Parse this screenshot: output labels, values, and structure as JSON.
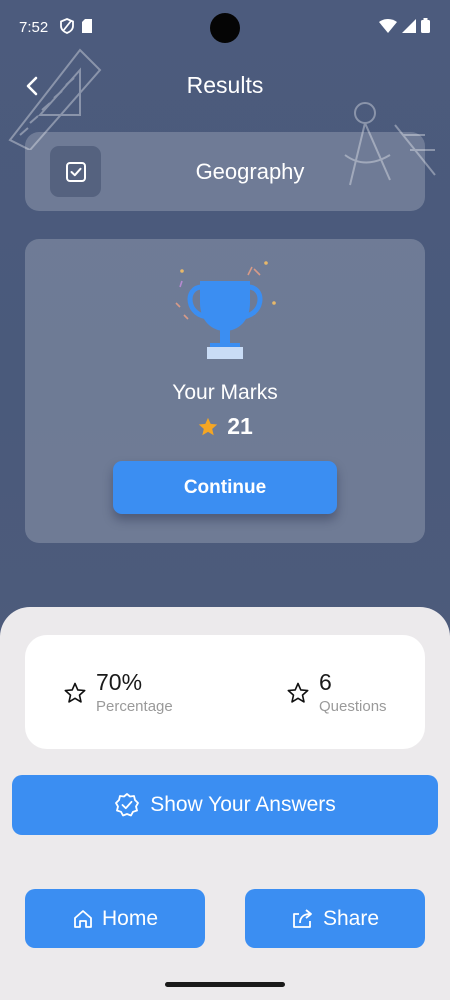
{
  "status_bar": {
    "time": "7:52"
  },
  "header": {
    "title": "Results"
  },
  "subject": {
    "name": "Geography"
  },
  "result": {
    "marks_label": "Your Marks",
    "marks_value": "21",
    "continue_label": "Continue"
  },
  "stats": {
    "percentage": {
      "value": "70%",
      "label": "Percentage"
    },
    "questions": {
      "value": "6",
      "label": "Questions"
    }
  },
  "actions": {
    "show_answers_label": "Show Your Answers",
    "home_label": "Home",
    "share_label": "Share"
  },
  "colors": {
    "accent": "#3b8ef2",
    "background": "#4a5a7c",
    "sheet": "#eceaec",
    "star": "#f5a623"
  }
}
